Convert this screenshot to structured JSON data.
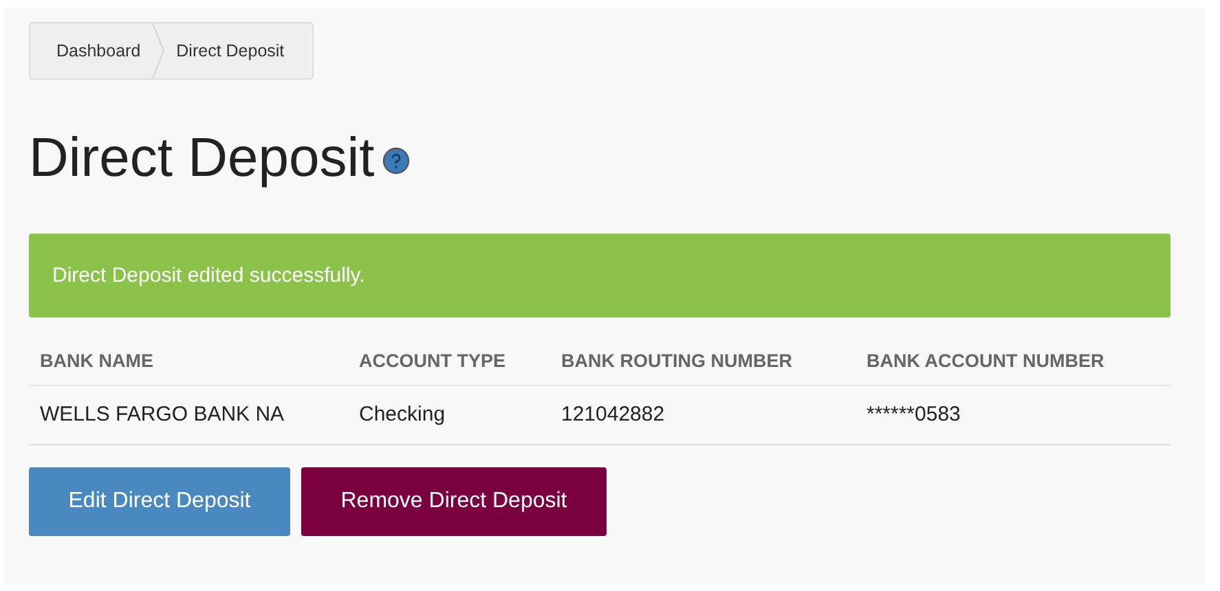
{
  "breadcrumb": [
    "Dashboard",
    "Direct Deposit"
  ],
  "title": "Direct Deposit",
  "alert": {
    "kind": "success",
    "text": "Direct Deposit edited successfully."
  },
  "table": {
    "columns": [
      "BANK NAME",
      "ACCOUNT TYPE",
      "BANK ROUTING NUMBER",
      "BANK ACCOUNT NUMBER"
    ],
    "rows": [
      [
        "WELLS FARGO BANK NA",
        "Checking",
        "121042882",
        "******0583"
      ]
    ]
  },
  "buttons": [
    {
      "kind": "primary",
      "label": "Edit Direct Deposit"
    },
    {
      "kind": "danger",
      "label": "Remove Direct Deposit"
    }
  ]
}
